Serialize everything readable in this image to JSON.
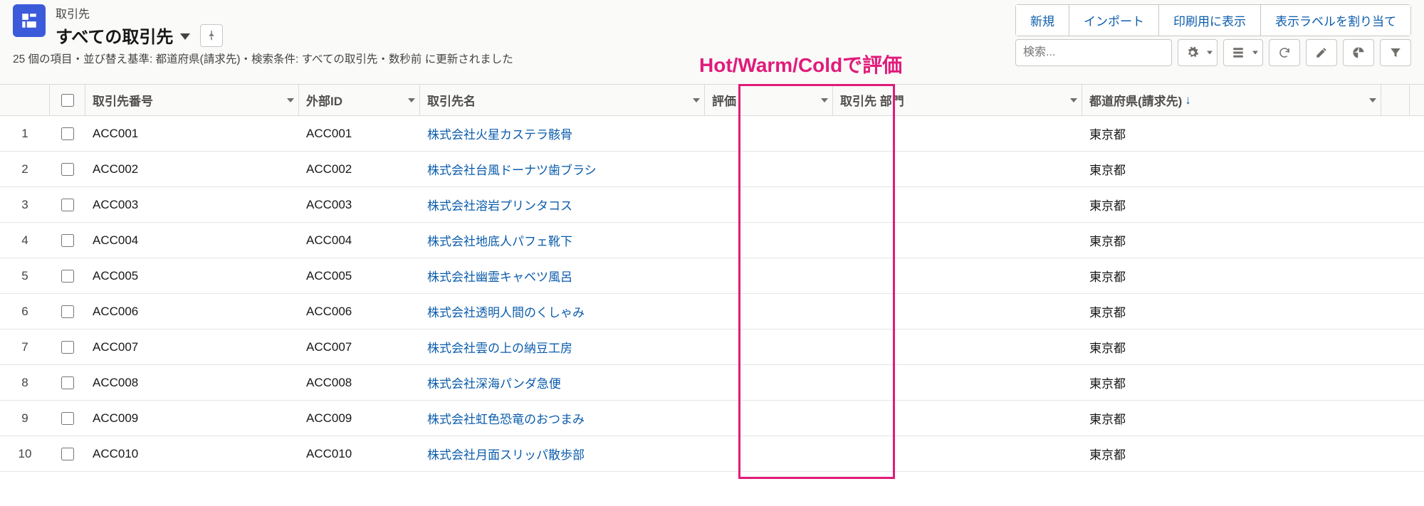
{
  "header": {
    "kicker": "取引先",
    "title": "すべての取引先"
  },
  "actions": {
    "new": "新規",
    "import": "インポート",
    "print_view": "印刷用に表示",
    "assign_label": "表示ラベルを割り当て"
  },
  "status_line": "25 個の項目・並び替え基準: 都道府県(請求先)・検索条件: すべての取引先・数秒前 に更新されました",
  "search": {
    "placeholder": "検索..."
  },
  "annotation": "Hot/Warm/Coldで評価",
  "columns": {
    "account_no": "取引先番号",
    "external_id": "外部ID",
    "account_name": "取引先名",
    "rating": "評価",
    "department": "取引先 部門",
    "prefecture": "都道府県(請求先)"
  },
  "rows": [
    {
      "n": "1",
      "acc": "ACC001",
      "ext": "ACC001",
      "name": "株式会社火星カステラ骸骨",
      "eval": "",
      "dept": "",
      "pref": "東京都"
    },
    {
      "n": "2",
      "acc": "ACC002",
      "ext": "ACC002",
      "name": "株式会社台風ドーナツ歯ブラシ",
      "eval": "",
      "dept": "",
      "pref": "東京都"
    },
    {
      "n": "3",
      "acc": "ACC003",
      "ext": "ACC003",
      "name": "株式会社溶岩プリンタコス",
      "eval": "",
      "dept": "",
      "pref": "東京都"
    },
    {
      "n": "4",
      "acc": "ACC004",
      "ext": "ACC004",
      "name": "株式会社地底人パフェ靴下",
      "eval": "",
      "dept": "",
      "pref": "東京都"
    },
    {
      "n": "5",
      "acc": "ACC005",
      "ext": "ACC005",
      "name": "株式会社幽霊キャベツ風呂",
      "eval": "",
      "dept": "",
      "pref": "東京都"
    },
    {
      "n": "6",
      "acc": "ACC006",
      "ext": "ACC006",
      "name": "株式会社透明人間のくしゃみ",
      "eval": "",
      "dept": "",
      "pref": "東京都"
    },
    {
      "n": "7",
      "acc": "ACC007",
      "ext": "ACC007",
      "name": "株式会社雲の上の納豆工房",
      "eval": "",
      "dept": "",
      "pref": "東京都"
    },
    {
      "n": "8",
      "acc": "ACC008",
      "ext": "ACC008",
      "name": "株式会社深海パンダ急便",
      "eval": "",
      "dept": "",
      "pref": "東京都"
    },
    {
      "n": "9",
      "acc": "ACC009",
      "ext": "ACC009",
      "name": "株式会社虹色恐竜のおつまみ",
      "eval": "",
      "dept": "",
      "pref": "東京都"
    },
    {
      "n": "10",
      "acc": "ACC010",
      "ext": "ACC010",
      "name": "株式会社月面スリッパ散歩部",
      "eval": "",
      "dept": "",
      "pref": "東京都"
    }
  ]
}
